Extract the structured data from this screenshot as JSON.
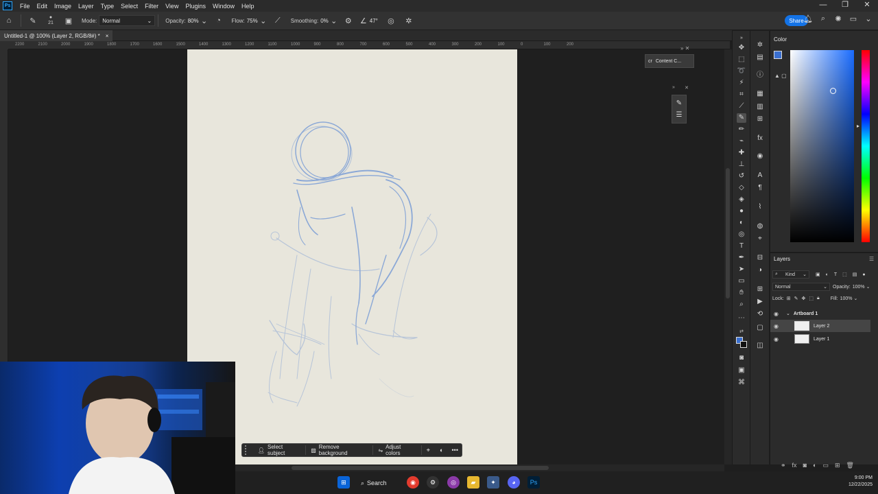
{
  "menu": [
    "File",
    "Edit",
    "Image",
    "Layer",
    "Type",
    "Select",
    "Filter",
    "View",
    "Plugins",
    "Window",
    "Help"
  ],
  "window_controls": {
    "minimize": "—",
    "restore": "❐",
    "close": "✕"
  },
  "options": {
    "brush_size": "21",
    "mode_label": "Mode:",
    "mode_value": "Normal",
    "opacity_label": "Opacity:",
    "opacity_value": "80%",
    "flow_label": "Flow:",
    "flow_value": "75%",
    "smoothing_label": "Smoothing:",
    "smoothing_value": "0%",
    "angle_value": "47°"
  },
  "share_label": "Share",
  "doc_tab": {
    "title": "Untitled-1 @ 100% (Layer 2, RGB/8#) *",
    "close": "×"
  },
  "ruler_labels": [
    "2200",
    "2100",
    "2000",
    "1900",
    "1800",
    "1700",
    "1600",
    "1500",
    "1400",
    "1300",
    "1200",
    "1100",
    "1000",
    "900",
    "800",
    "700",
    "600",
    "500",
    "400",
    "300",
    "200",
    "100",
    "0",
    "100",
    "200"
  ],
  "content_credentials": "Content C...",
  "context_bar": {
    "select_subject": "Select subject",
    "remove_background": "Remove background",
    "adjust_colors": "Adjust colors",
    "more": "•••"
  },
  "color_panel": {
    "title": "Color",
    "fg_color": "#3a6fd0",
    "bg_color": "#111111"
  },
  "layers_panel": {
    "title": "Layers",
    "filter_kind": "Kind",
    "blend_mode": "Normal",
    "opacity_label": "Opacity:",
    "opacity_value": "100%",
    "lock_label": "Lock:",
    "fill_label": "Fill:",
    "fill_value": "100%",
    "artboard_name": "Artboard 1",
    "layers": [
      {
        "name": "Layer 2",
        "selected": true
      },
      {
        "name": "Layer 1",
        "selected": false
      }
    ]
  },
  "taskbar": {
    "search_label": "Search",
    "time": "9:00 PM",
    "date": "12/22/2025"
  }
}
